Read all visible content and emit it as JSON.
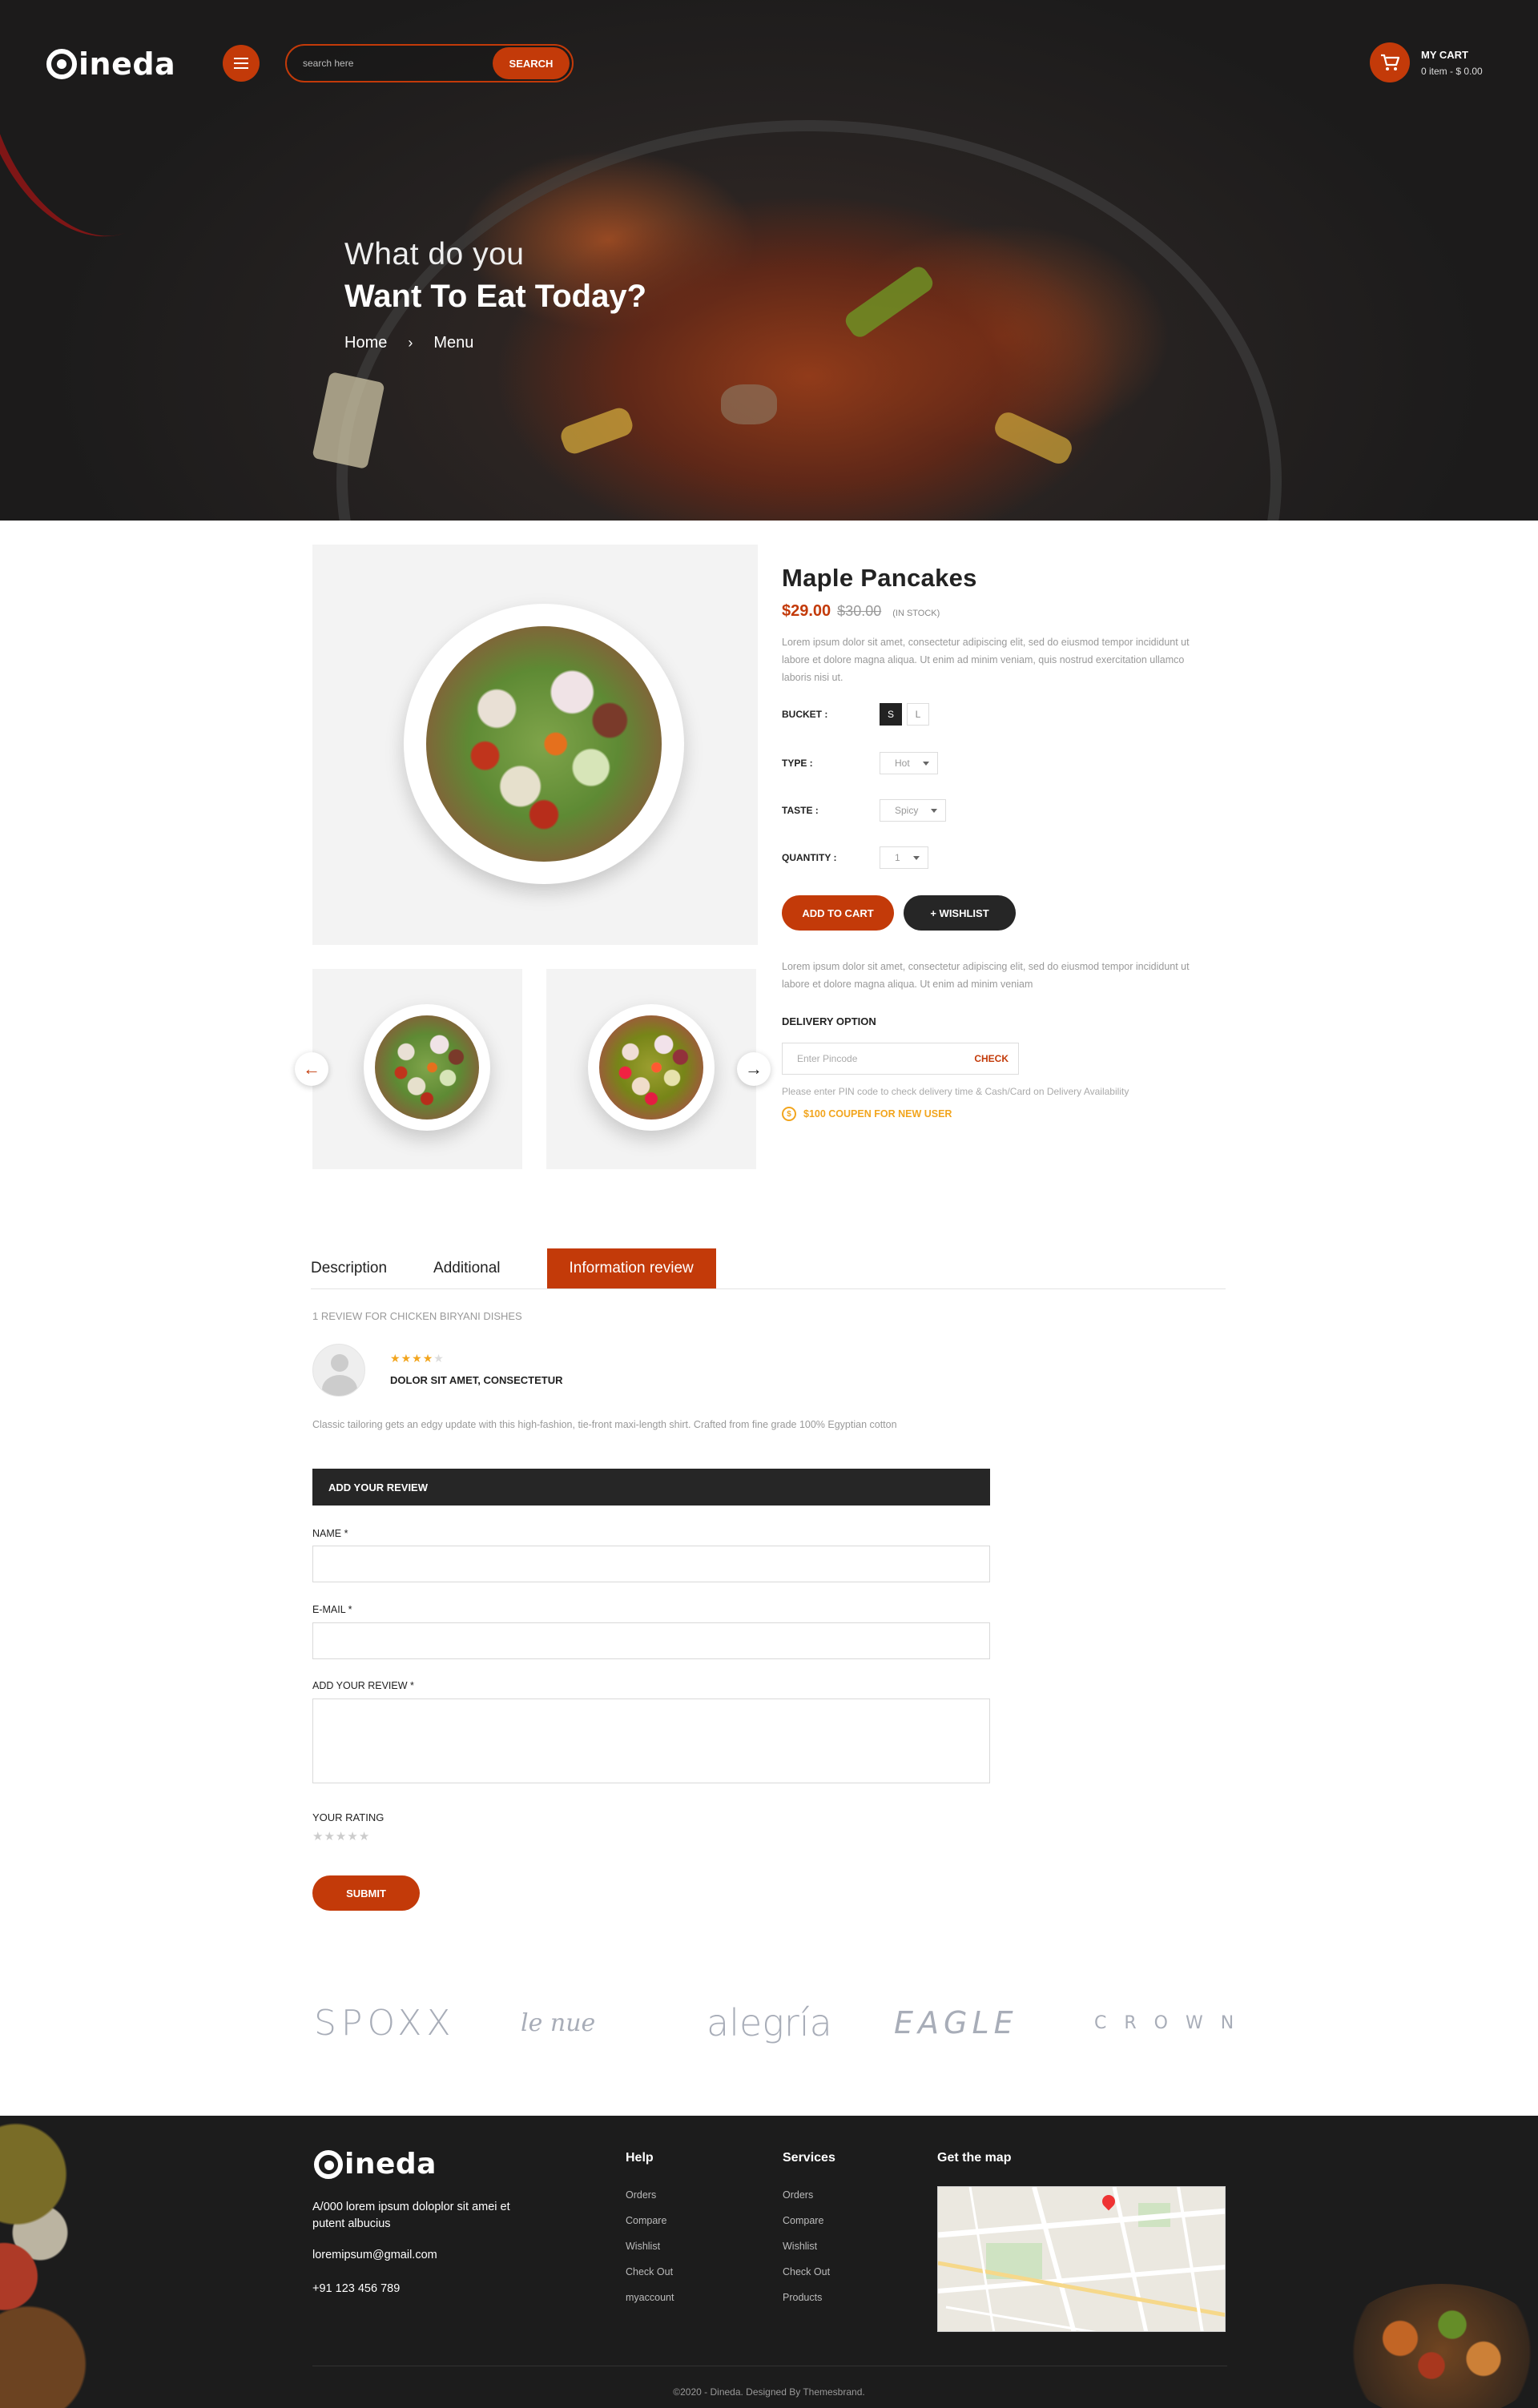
{
  "header": {
    "logo": "ineda",
    "search": {
      "placeholder": "search here",
      "button": "SEARCH"
    },
    "cart": {
      "title": "MY CART",
      "summary": "0 item - $ 0.00"
    }
  },
  "hero": {
    "line1": "What do you",
    "line2": "Want To Eat Today?",
    "breadcrumb": {
      "home": "Home",
      "separator": "›",
      "current": "Menu"
    }
  },
  "product": {
    "title": "Maple Pancakes",
    "price": "$29.00",
    "old_price": "$30.00",
    "stock": "(IN STOCK)",
    "description": "Lorem ipsum dolor sit amet, consectetur adipiscing elit, sed do eiusmod tempor incididunt ut labore et dolore magna aliqua. Ut enim ad minim veniam, quis nostrud exercitation ullamco laboris nisi ut.",
    "options": {
      "bucket_label": "BUCKET :",
      "bucket_sizes": [
        "S",
        "L"
      ],
      "type_label": "TYPE :",
      "type_value": "Hot",
      "taste_label": "TASTE :",
      "taste_value": "Spicy",
      "quantity_label": "QUANTITY :",
      "quantity_value": "1"
    },
    "add_to_cart": "ADD TO CART",
    "wishlist": "+ WISHLIST",
    "description2": "Lorem ipsum dolor sit amet, consectetur adipiscing elit, sed do eiusmod tempor incididunt ut labore et dolore magna aliqua. Ut enim ad minim veniam",
    "delivery": {
      "label": "DELIVERY OPTION",
      "placeholder": "Enter Pincode",
      "check": "CHECK",
      "note": "Please enter PIN code to check delivery time & Cash/Card on Delivery Availability",
      "coupon": "$100 COUPEN FOR NEW USER"
    }
  },
  "tabs": [
    "Description",
    "Additional",
    "Information review"
  ],
  "reviews": {
    "count_text": "1 REVIEW FOR CHICKEN BIRYANI DISHES",
    "rating": 4,
    "rating_max": 5,
    "review_title": "DOLOR SIT AMET, CONSECTETUR",
    "review_text": "Classic tailoring gets an edgy update with this high-fashion, tie-front maxi-length shirt. Crafted from fine grade 100% Egyptian cotton"
  },
  "form": {
    "header": "ADD YOUR REVIEW",
    "name_label": "NAME *",
    "email_label": "E-MAIL *",
    "review_label": "ADD YOUR REVIEW *",
    "rating_label": "YOUR RATING",
    "submit": "SUBMIT"
  },
  "brands": [
    "SPOXX",
    "le nue",
    "alegría",
    "EAGLE",
    "CROWN"
  ],
  "footer": {
    "logo": "ineda",
    "address": "A/000  lorem ipsum doloplor sit amei et putent albucius",
    "email": "loremipsum@gmail.com",
    "phone": "+91 123 456 789",
    "help": {
      "title": "Help",
      "links": [
        "Orders",
        "Compare",
        "Wishlist",
        "Check Out",
        "myaccount"
      ]
    },
    "services": {
      "title": "Services",
      "links": [
        "Orders",
        "Compare",
        "Wishlist",
        "Check Out",
        "Products"
      ]
    },
    "map_title": "Get the map",
    "copyright": "©2020 - Dineda. Designed By Themesbrand."
  },
  "colors": {
    "accent": "#c33a09",
    "dark": "#262626",
    "star": "#f2a51e"
  }
}
